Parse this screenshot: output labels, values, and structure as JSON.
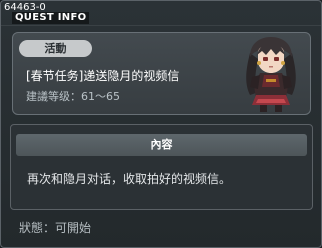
{
  "window": {
    "id_label": "64463-0",
    "title": "QUEST INFO"
  },
  "quest": {
    "category_badge": "活動",
    "name": "[春节任务]递送隐月的视频信",
    "recommended_level": "建議等级：61～65",
    "npc_icon": "npc-portrait"
  },
  "content": {
    "header": "內容",
    "description": "再次和隐月对话，收取拍好的视频信。"
  },
  "status": {
    "text": "狀態：可開始"
  },
  "colors": {
    "background": "#23292c",
    "card": "#3d4348",
    "badge": "#c6c9cb",
    "header_bar": "#565e63"
  }
}
